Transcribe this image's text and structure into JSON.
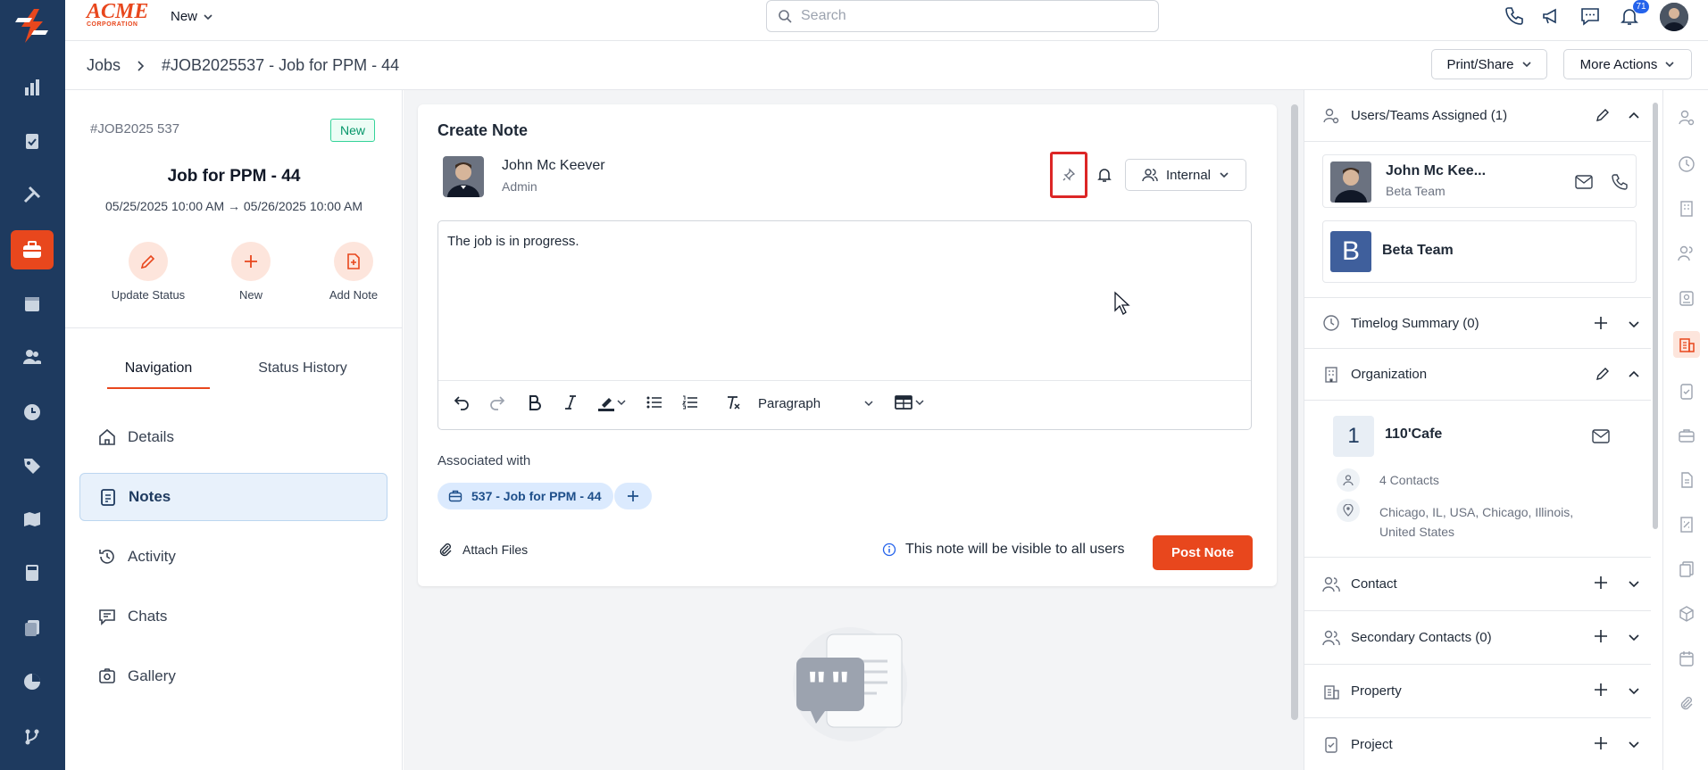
{
  "app": {
    "logo_text": "ACME",
    "logo_sub": "CORPORATION",
    "new_menu": "New"
  },
  "search": {
    "placeholder": "Search"
  },
  "notifications": {
    "count": "71"
  },
  "breadcrumb": {
    "root": "Jobs",
    "current": "#JOB2025537 - Job for PPM - 44"
  },
  "header_actions": {
    "print_share": "Print/Share",
    "more_actions": "More Actions"
  },
  "job": {
    "id": "#JOB2025 537",
    "status": "New",
    "title": "Job for PPM - 44",
    "dates": "05/25/2025 10:00 AM → 05/26/2025 10:00 AM"
  },
  "quick_actions": [
    {
      "label": "Update Status",
      "icon": "pencil-icon"
    },
    {
      "label": "New",
      "icon": "plus-icon"
    },
    {
      "label": "Add Note",
      "icon": "note-add-icon"
    }
  ],
  "tabs": {
    "navigation": "Navigation",
    "status_history": "Status History"
  },
  "nav_items": [
    {
      "label": "Details",
      "icon": "home-icon"
    },
    {
      "label": "Notes",
      "icon": "clipboard-icon"
    },
    {
      "label": "Activity",
      "icon": "history-icon"
    },
    {
      "label": "Chats",
      "icon": "chat-icon"
    },
    {
      "label": "Gallery",
      "icon": "gallery-icon"
    }
  ],
  "note": {
    "heading": "Create Note",
    "author_name": "John Mc Keever",
    "author_role": "Admin",
    "visibility": "Internal",
    "body": "The job is in progress.",
    "format": "Paragraph",
    "associated_label": "Associated with",
    "associated_chip": "537 - Job for PPM - 44",
    "attach_label": "Attach Files",
    "visibility_notice": "This note will be visible to all users",
    "post_label": "Post Note"
  },
  "right": {
    "users_teams": "Users/Teams Assigned (1)",
    "assignee_name": "John Mc Kee...",
    "assignee_team": "Beta Team",
    "team_initial": "B",
    "team_name": "Beta Team",
    "timelog": "Timelog Summary (0)",
    "organization": "Organization",
    "org_initial": "1",
    "org_name": "110'Cafe",
    "org_contacts": "4 Contacts",
    "org_address": "Chicago, IL, USA, Chicago, Illinois, United States",
    "contact": "Contact",
    "secondary_contacts": "Secondary Contacts (0)",
    "property": "Property",
    "project": "Project"
  },
  "colors": {
    "brand": "#e8471d",
    "rail": "#1e3a5f",
    "team_avatar": "#3f5f9c"
  }
}
